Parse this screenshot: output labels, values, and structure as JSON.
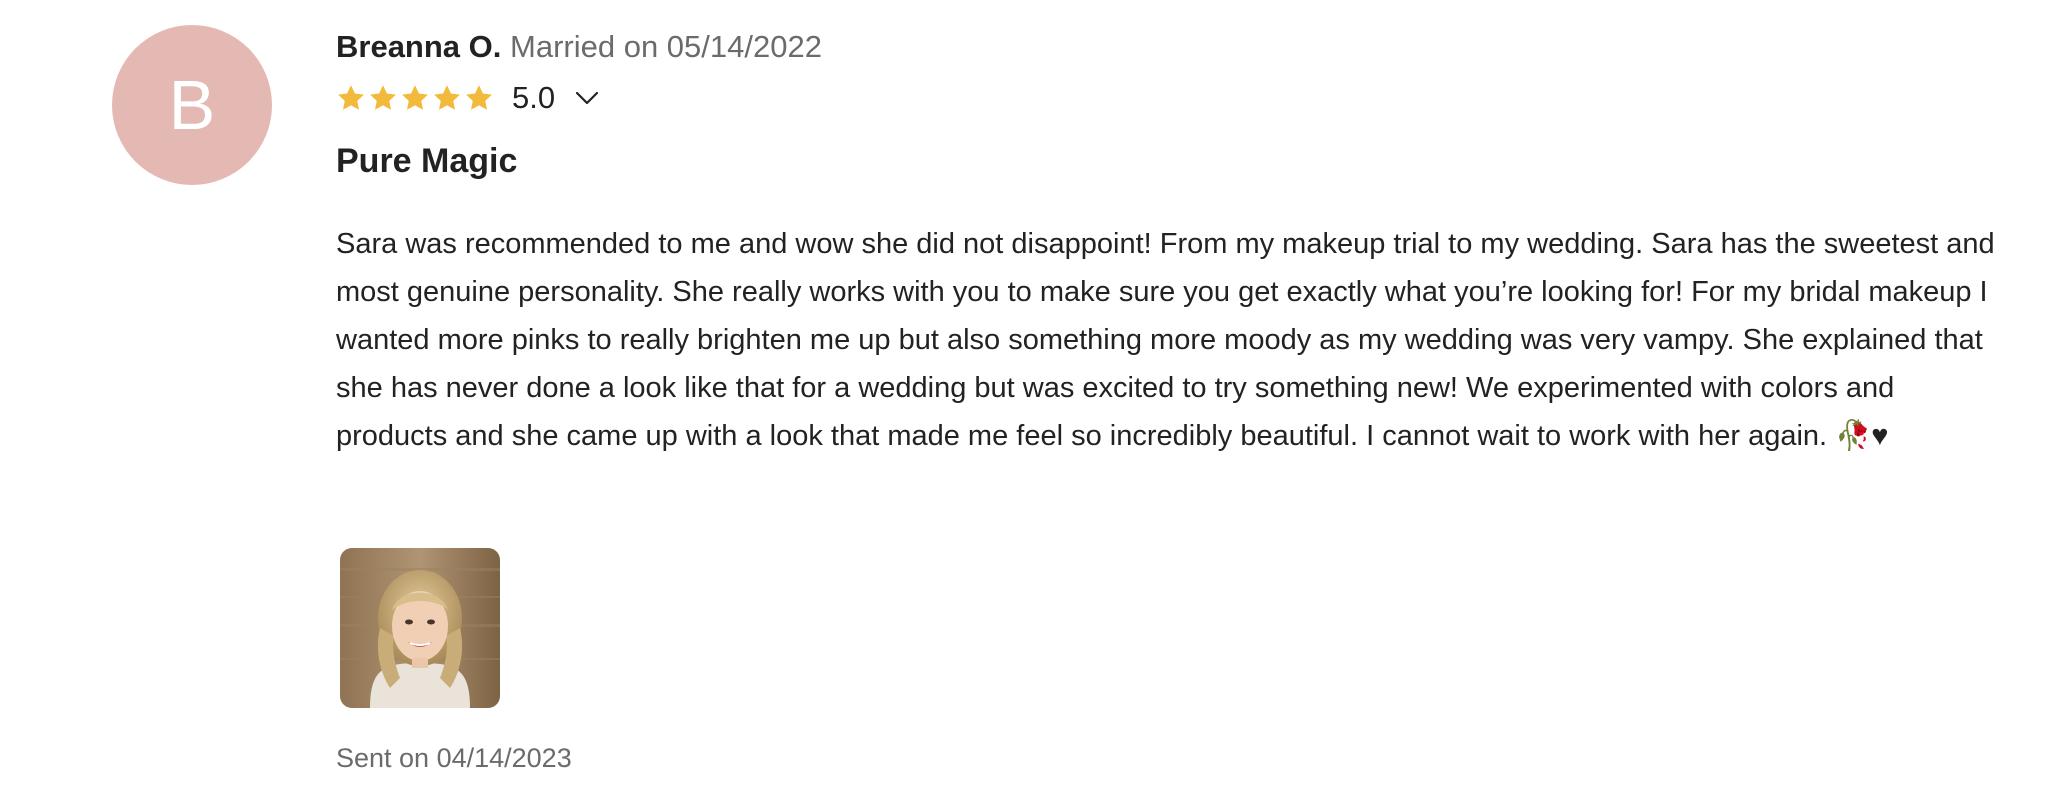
{
  "review": {
    "avatar_initial": "B",
    "reviewer_name": "Breanna O.",
    "married_text": "Married on 05/14/2022",
    "rating": {
      "stars": 5,
      "value_label": "5.0",
      "star_icon": "star-icon",
      "expand_icon": "chevron-down-icon"
    },
    "title": "Pure Magic",
    "body": "Sara was recommended to me and wow she did not disappoint! From my makeup trial to my wedding. Sara has the sweetest and most genuine personality. She really works with you to make sure you get exactly what you’re looking for! For my bridal makeup I wanted more pinks to really brighten me up but also something more moody as my wedding was very vampy. She explained that she has never done a look like that for a wedding but was excited to try something new! We experimented with colors and products and she came up with a look that made me feel so incredibly beautiful. I cannot wait to work with her again. 🥀♥",
    "sent_text": "Sent on 04/14/2023"
  },
  "colors": {
    "avatar_bg": "#e5b9b3",
    "star": "#f3b93b",
    "muted_text": "#6b6b6b",
    "text": "#222222"
  }
}
